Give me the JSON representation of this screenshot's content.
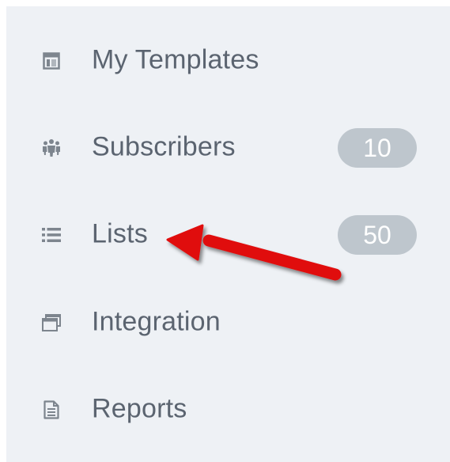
{
  "nav": {
    "items": [
      {
        "id": "my-templates",
        "label": "My Templates",
        "icon": "template-icon",
        "badge": null
      },
      {
        "id": "subscribers",
        "label": "Subscribers",
        "icon": "users-icon",
        "badge": "10"
      },
      {
        "id": "lists",
        "label": "Lists",
        "icon": "list-icon",
        "badge": "50"
      },
      {
        "id": "integration",
        "label": "Integration",
        "icon": "window-stack-icon",
        "badge": null
      },
      {
        "id": "reports",
        "label": "Reports",
        "icon": "document-icon",
        "badge": null
      }
    ]
  },
  "annotation": {
    "arrow_color": "#e01010",
    "points_to": "lists"
  },
  "colors": {
    "sidebar_bg": "#eef1f5",
    "label": "#5b6470",
    "icon": "#7d858e",
    "badge_bg": "#bec6cd",
    "badge_text": "#ffffff"
  }
}
